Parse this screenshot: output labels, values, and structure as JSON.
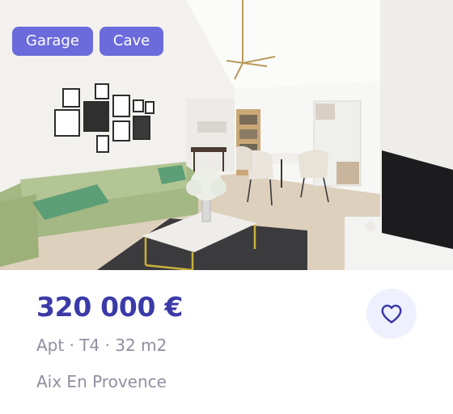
{
  "listing": {
    "tags": [
      "Garage",
      "Cave"
    ],
    "price": "320 000 €",
    "details": "Apt · T4 · 32 m2",
    "city": "Aix En Provence"
  },
  "colors": {
    "tag_background": "#6b6bdc",
    "price": "#3b3aa8",
    "secondary_text": "#8f8fa0",
    "favorite_background": "#eff0fd"
  },
  "icons": {
    "favorite": "heart-outline-icon"
  }
}
